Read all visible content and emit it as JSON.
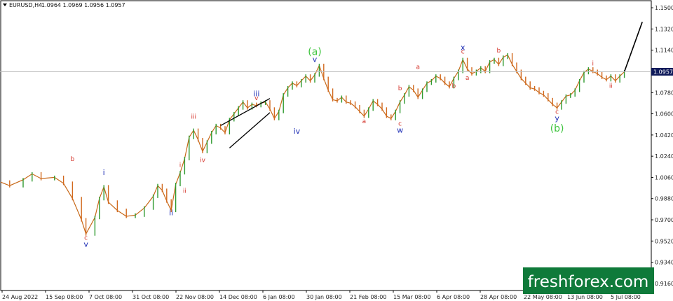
{
  "header": {
    "symbol": "EURUSD,H4",
    "ohlc": "1.0964 1.0969 1.0956 1.0957"
  },
  "chart_data": {
    "type": "line",
    "title": "EURUSD,H4",
    "x_ticks": [
      "24 Aug 2022",
      "15 Sep 08:00",
      "7 Oct 08:00",
      "31 Oct 08:00",
      "22 Nov 08:00",
      "14 Dec 08:00",
      "6 Jan 08:00",
      "30 Jan 08:00",
      "21 Feb 08:00",
      "15 Mar 08:00",
      "6 Apr 08:00",
      "28 Apr 08:00",
      "22 May 08:00",
      "13 Jun 08:00",
      "5 Jul 08:00"
    ],
    "y_ticks": [
      "1.1500",
      "1.1320",
      "1.1140",
      "1.0960",
      "1.0780",
      "1.0600",
      "1.0420",
      "1.0240",
      "1.0060",
      "0.9880",
      "0.9700",
      "0.9520",
      "0.9340",
      "0.9160"
    ],
    "ylim": [
      0.91,
      1.156
    ],
    "current_price": "1.0957",
    "grid": false,
    "series": [
      {
        "values": [
          [
            0,
            1.002
          ],
          [
            2,
            0.999
          ],
          [
            5,
            1.004
          ],
          [
            7,
            1.009
          ],
          [
            9,
            1.005
          ],
          [
            12,
            1.006
          ],
          [
            14,
            1.001
          ],
          [
            16,
            0.988
          ],
          [
            18,
            0.97
          ],
          [
            19,
            0.958
          ],
          [
            21,
            0.972
          ],
          [
            22,
            0.988
          ],
          [
            23,
            0.998
          ],
          [
            24,
            0.985
          ],
          [
            26,
            0.978
          ],
          [
            28,
            0.973
          ],
          [
            30,
            0.974
          ],
          [
            32,
            0.98
          ],
          [
            34,
            0.99
          ],
          [
            35,
            0.999
          ],
          [
            36,
            0.995
          ],
          [
            37,
            0.986
          ],
          [
            38,
            0.978
          ],
          [
            39,
            1.0
          ],
          [
            40,
            1.01
          ],
          [
            41,
            1.022
          ],
          [
            42,
            1.04
          ],
          [
            43,
            1.046
          ],
          [
            44,
            1.038
          ],
          [
            45,
            1.028
          ],
          [
            46,
            1.036
          ],
          [
            47,
            1.044
          ],
          [
            48,
            1.05
          ],
          [
            49,
            1.048
          ],
          [
            50,
            1.044
          ],
          [
            51,
            1.055
          ],
          [
            52,
            1.06
          ],
          [
            53,
            1.065
          ],
          [
            54,
            1.07
          ],
          [
            55,
            1.065
          ],
          [
            56,
            1.068
          ],
          [
            57,
            1.067
          ],
          [
            58,
            1.069
          ],
          [
            59,
            1.07
          ],
          [
            60,
            1.064
          ],
          [
            61,
            1.056
          ],
          [
            62,
            1.062
          ],
          [
            63,
            1.076
          ],
          [
            64,
            1.082
          ],
          [
            65,
            1.086
          ],
          [
            66,
            1.084
          ],
          [
            67,
            1.088
          ],
          [
            68,
            1.092
          ],
          [
            69,
            1.088
          ],
          [
            70,
            1.093
          ],
          [
            71,
            1.101
          ],
          [
            72,
            1.09
          ],
          [
            73,
            1.08
          ],
          [
            74,
            1.072
          ],
          [
            75,
            1.071
          ],
          [
            76,
            1.074
          ],
          [
            77,
            1.07
          ],
          [
            78,
            1.069
          ],
          [
            79,
            1.066
          ],
          [
            80,
            1.062
          ],
          [
            81,
            1.058
          ],
          [
            82,
            1.064
          ],
          [
            83,
            1.071
          ],
          [
            84,
            1.068
          ],
          [
            85,
            1.064
          ],
          [
            86,
            1.058
          ],
          [
            87,
            1.056
          ],
          [
            88,
            1.062
          ],
          [
            89,
            1.07
          ],
          [
            90,
            1.076
          ],
          [
            91,
            1.083
          ],
          [
            92,
            1.08
          ],
          [
            93,
            1.074
          ],
          [
            94,
            1.08
          ],
          [
            95,
            1.086
          ],
          [
            96,
            1.088
          ],
          [
            97,
            1.092
          ],
          [
            98,
            1.09
          ],
          [
            99,
            1.086
          ],
          [
            100,
            1.083
          ],
          [
            101,
            1.09
          ],
          [
            102,
            1.096
          ],
          [
            103,
            1.106
          ],
          [
            104,
            1.098
          ],
          [
            105,
            1.094
          ],
          [
            106,
            1.096
          ],
          [
            107,
            1.099
          ],
          [
            108,
            1.096
          ],
          [
            109,
            1.104
          ],
          [
            110,
            1.106
          ],
          [
            111,
            1.102
          ],
          [
            112,
            1.108
          ],
          [
            113,
            1.11
          ],
          [
            114,
            1.102
          ],
          [
            115,
            1.096
          ],
          [
            116,
            1.09
          ],
          [
            117,
            1.086
          ],
          [
            118,
            1.082
          ],
          [
            119,
            1.081
          ],
          [
            120,
            1.078
          ],
          [
            121,
            1.076
          ],
          [
            122,
            1.072
          ],
          [
            123,
            1.068
          ],
          [
            124,
            1.065
          ],
          [
            125,
            1.07
          ],
          [
            126,
            1.075
          ],
          [
            127,
            1.076
          ],
          [
            128,
            1.08
          ],
          [
            129,
            1.088
          ],
          [
            130,
            1.095
          ],
          [
            131,
            1.098
          ],
          [
            132,
            1.096
          ],
          [
            133,
            1.094
          ],
          [
            134,
            1.091
          ],
          [
            135,
            1.089
          ],
          [
            136,
            1.092
          ],
          [
            137,
            1.088
          ],
          [
            138,
            1.092
          ],
          [
            139,
            1.0957
          ]
        ]
      },
      {
        "values": [
          [
            139,
            1.0957
          ],
          [
            143,
            1.138
          ]
        ]
      }
    ],
    "channel_lines": [
      [
        [
          49,
          1.05
        ],
        [
          60,
          1.073
        ]
      ],
      [
        [
          51,
          1.031
        ],
        [
          60,
          1.061
        ]
      ]
    ],
    "wave_labels": [
      {
        "text": "b",
        "x": 16.0,
        "y": 1.02,
        "color": "#d4332a",
        "size": 9
      },
      {
        "text": "c",
        "x": 19.0,
        "y": 0.953,
        "color": "#d4332a",
        "size": 9
      },
      {
        "text": "v",
        "x": 19.0,
        "y": 0.947,
        "color": "#1f2fb5",
        "size": 11
      },
      {
        "text": "i",
        "x": 23.0,
        "y": 1.008,
        "color": "#1f2fb5",
        "size": 11
      },
      {
        "text": "ii",
        "x": 38.0,
        "y": 0.974,
        "color": "#1f2fb5",
        "size": 11
      },
      {
        "text": "i",
        "x": 40.0,
        "y": 1.015,
        "color": "#d4332a",
        "size": 9
      },
      {
        "text": "ii",
        "x": 41.0,
        "y": 0.993,
        "color": "#d4332a",
        "size": 9
      },
      {
        "text": "iii",
        "x": 43.0,
        "y": 1.056,
        "color": "#d4332a",
        "size": 9
      },
      {
        "text": "iv",
        "x": 45.0,
        "y": 1.019,
        "color": "#d4332a",
        "size": 9
      },
      {
        "text": "iii",
        "x": 57.0,
        "y": 1.075,
        "color": "#1f2fb5",
        "size": 11
      },
      {
        "text": "v",
        "x": 57.0,
        "y": 1.0715,
        "color": "#d4332a",
        "size": 9
      },
      {
        "text": "iv",
        "x": 66.0,
        "y": 1.043,
        "color": "#1f2fb5",
        "size": 11
      },
      {
        "text": "(a)",
        "x": 70.0,
        "y": 1.11,
        "color": "#3ec43e",
        "size": 14
      },
      {
        "text": "v",
        "x": 70.0,
        "y": 1.104,
        "color": "#1f2fb5",
        "size": 11
      },
      {
        "text": "a",
        "x": 81.0,
        "y": 1.052,
        "color": "#d4332a",
        "size": 9
      },
      {
        "text": "b",
        "x": 89.0,
        "y": 1.08,
        "color": "#d4332a",
        "size": 9
      },
      {
        "text": "c",
        "x": 89.0,
        "y": 1.05,
        "color": "#d4332a",
        "size": 9
      },
      {
        "text": "w",
        "x": 89.0,
        "y": 1.044,
        "color": "#1f2fb5",
        "size": 11
      },
      {
        "text": "a",
        "x": 93.0,
        "y": 1.098,
        "color": "#d4332a",
        "size": 9
      },
      {
        "text": "b",
        "x": 101.0,
        "y": 1.082,
        "color": "#d4332a",
        "size": 9
      },
      {
        "text": "x",
        "x": 103.0,
        "y": 1.114,
        "color": "#1f2fb5",
        "size": 11
      },
      {
        "text": "c",
        "x": 103.0,
        "y": 1.111,
        "color": "#d4332a",
        "size": 9
      },
      {
        "text": "a",
        "x": 104.0,
        "y": 1.089,
        "color": "#d4332a",
        "size": 9
      },
      {
        "text": "b",
        "x": 111.0,
        "y": 1.112,
        "color": "#d4332a",
        "size": 9
      },
      {
        "text": "c",
        "x": 124.0,
        "y": 1.06,
        "color": "#d4332a",
        "size": 9
      },
      {
        "text": "y",
        "x": 124.0,
        "y": 1.054,
        "color": "#1f2fb5",
        "size": 11
      },
      {
        "text": "(b)",
        "x": 124.0,
        "y": 1.045,
        "color": "#3ec43e",
        "size": 14
      },
      {
        "text": "i",
        "x": 132.0,
        "y": 1.101,
        "color": "#d4332a",
        "size": 9
      },
      {
        "text": "ii",
        "x": 136.0,
        "y": 1.082,
        "color": "#d4332a",
        "size": 9
      }
    ]
  },
  "watermark": {
    "text": "freshforex.com"
  }
}
